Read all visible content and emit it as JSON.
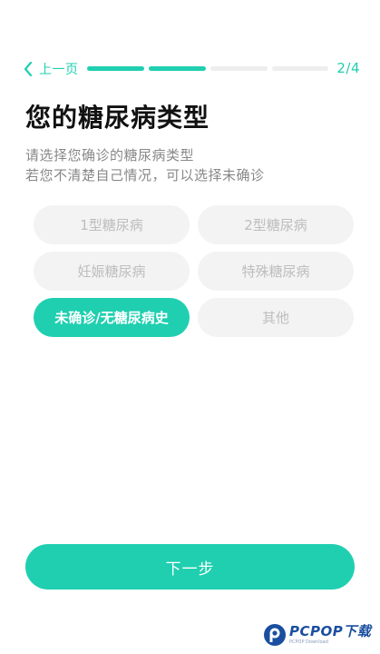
{
  "nav": {
    "back_label": "上一页",
    "step": "2/4",
    "progress_completed": 2,
    "progress_total": 4
  },
  "title": "您的糖尿病类型",
  "subtitle_lines": [
    "请选择您确诊的糖尿病类型",
    "若您不清楚自己情况，可以选择未确诊"
  ],
  "options": [
    {
      "label": "1型糖尿病",
      "selected": false
    },
    {
      "label": "2型糖尿病",
      "selected": false
    },
    {
      "label": "妊娠糖尿病",
      "selected": false
    },
    {
      "label": "特殊糖尿病",
      "selected": false
    },
    {
      "label": "未确诊/无糖尿病史",
      "selected": true
    },
    {
      "label": "其他",
      "selected": false
    }
  ],
  "next_label": "下一步",
  "watermark": {
    "main": "PCPOP下载",
    "small": "PCPOP Download"
  },
  "colors": {
    "accent": "#1fcfb0",
    "option_bg": "#f3f3f3",
    "option_text": "#bdbdbd",
    "progress_inactive": "#eeeeee"
  }
}
